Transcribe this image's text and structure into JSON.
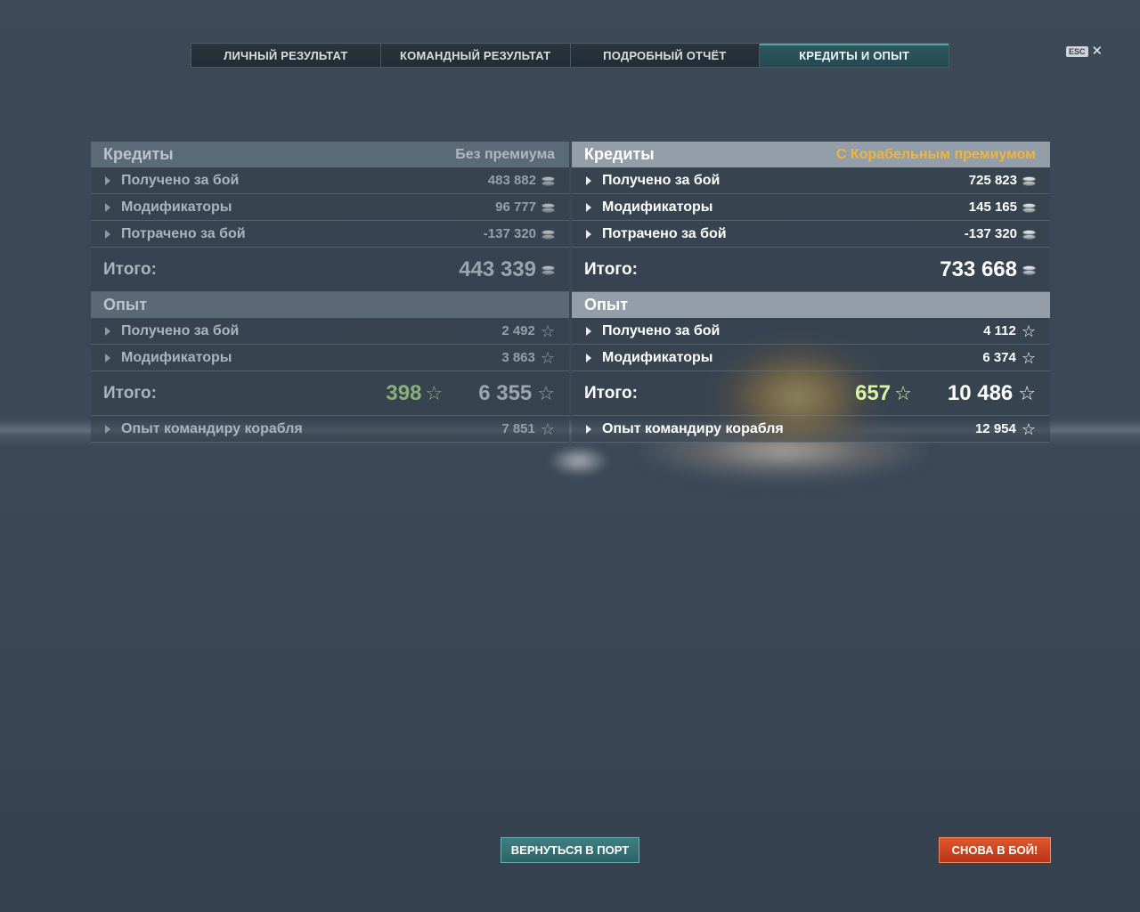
{
  "tabs": [
    {
      "label": "ЛИЧНЫЙ РЕЗУЛЬТАТ"
    },
    {
      "label": "КОМАНДНЫЙ РЕЗУЛЬТАТ"
    },
    {
      "label": "ПОДРОБНЫЙ ОТЧЁТ"
    },
    {
      "label": "КРЕДИТЫ И ОПЫТ",
      "active": true
    }
  ],
  "close": {
    "esc_label": "ESC",
    "icon": "close-icon"
  },
  "colors": {
    "premium_accent": "#f0b43c",
    "bonus_left": "#86b07a",
    "bonus_right": "#d9f3a0",
    "battle_button": "#d14a22",
    "port_button": "#357276"
  },
  "left": {
    "credits": {
      "title": "Кредиты",
      "subtitle": "Без премиума",
      "rows": [
        {
          "label": "Получено за бой",
          "value": "483 882"
        },
        {
          "label": "Модификаторы",
          "value": "96 777"
        },
        {
          "label": "Потрачено за бой",
          "value": "-137 320"
        }
      ],
      "total_label": "Итого:",
      "total_value": "443 339"
    },
    "exp": {
      "title": "Опыт",
      "rows": [
        {
          "label": "Получено за бой",
          "value": "2 492"
        },
        {
          "label": "Модификаторы",
          "value": "3 863"
        }
      ],
      "total_label": "Итого:",
      "bonus_value": "398",
      "total_value": "6 355",
      "commander_label": "Опыт командиру корабля",
      "commander_value": "7 851"
    }
  },
  "right": {
    "credits": {
      "title": "Кредиты",
      "subtitle": "С Корабельным премиумом",
      "rows": [
        {
          "label": "Получено за бой",
          "value": "725 823"
        },
        {
          "label": "Модификаторы",
          "value": "145 165"
        },
        {
          "label": "Потрачено за бой",
          "value": "-137 320"
        }
      ],
      "total_label": "Итого:",
      "total_value": "733 668"
    },
    "exp": {
      "title": "Опыт",
      "rows": [
        {
          "label": "Получено за бой",
          "value": "4 112"
        },
        {
          "label": "Модификаторы",
          "value": "6 374"
        }
      ],
      "total_label": "Итого:",
      "bonus_value": "657",
      "total_value": "10 486",
      "commander_label": "Опыт командиру корабля",
      "commander_value": "12 954"
    }
  },
  "buttons": {
    "port": "ВЕРНУТЬСЯ В ПОРТ",
    "battle": "СНОВА В БОЙ!"
  }
}
